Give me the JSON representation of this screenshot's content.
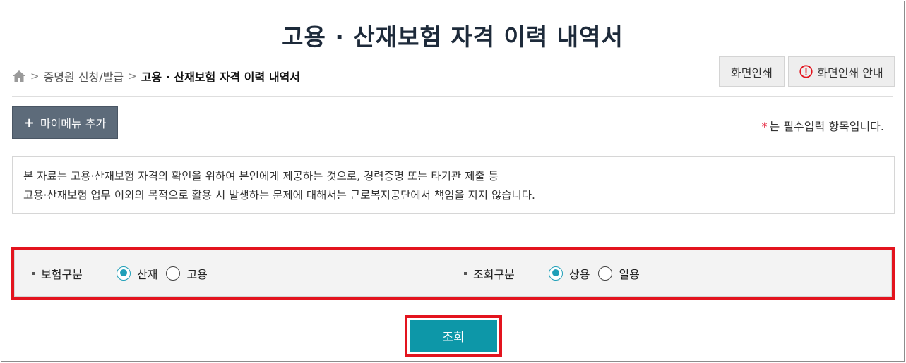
{
  "page": {
    "title": "고용 · 산재보험 자격 이력 내역서"
  },
  "breadcrumb": {
    "items": [
      "증명원 신청/발급"
    ],
    "current": "고용 · 산재보험 자격 이력 내역서"
  },
  "toolbar": {
    "print_label": "화면인쇄",
    "print_guide_label": "화면인쇄 안내"
  },
  "mymenu": {
    "plus": "+",
    "label": "마이메뉴 추가"
  },
  "required_note": {
    "star": "*",
    "text": "는 필수입력 항목입니다."
  },
  "notice": {
    "line1": "본 자료는 고용·산재보험 자격의 확인을 위하여 본인에게 제공하는 것으로, 경력증명 또는 타기관 제출 등",
    "line2": "고용·산재보험 업무 이외의 목적으로 활용 시 발생하는 문제에 대해서는 근로복지공단에서 책임을 지지 않습니다."
  },
  "search": {
    "insurance_type": {
      "label": "보험구분",
      "options": [
        {
          "label": "산재",
          "selected": true
        },
        {
          "label": "고용",
          "selected": false
        }
      ]
    },
    "query_type": {
      "label": "조회구분",
      "options": [
        {
          "label": "상용",
          "selected": true
        },
        {
          "label": "일용",
          "selected": false
        }
      ]
    }
  },
  "actions": {
    "lookup_label": "조회"
  },
  "colors": {
    "title": "#1d2a3a",
    "accent": "#0d97a8",
    "radio_selected": "#1f9fb8",
    "highlight": "#e3141e",
    "mymenu_bg": "#5d6b7a",
    "required_star": "#e8384f"
  }
}
